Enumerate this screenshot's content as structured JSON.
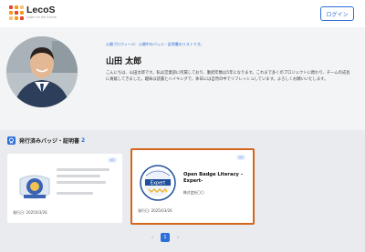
{
  "header": {
    "logo_name": "LecoS",
    "logo_tagline": "Learn for the Future",
    "login_label": "ログイン"
  },
  "profile": {
    "breadcrumb": "公開プロフィール：公開中のバッジ・証明書のリストです。",
    "name": "山田 太郎",
    "bio": "こんにちは、山田太郎です。私は営業部に所属しており、勤続年数は5年になります。これまで多くのプロジェクトに携わり、チームの成長に貢献してきました。趣味は読書とハイキングで、休日には自然の中でリフレッシュしています。よろしくお願いいたします。"
  },
  "badges": {
    "title": "発行済みバッジ・証明書",
    "count": "2",
    "cards": [
      {
        "pill": "v1",
        "title": "",
        "issuer": "",
        "date": "発行日: 2025/03/26"
      },
      {
        "pill": "v1",
        "title": "Open Badge Literacy -Expert-",
        "issuer": "株式会社〇〇",
        "date": "発行日: 2025/03/26"
      }
    ]
  },
  "pagination": {
    "prev": "‹",
    "current": "1",
    "next": "›"
  },
  "colors": {
    "accent": "#2f6fd8",
    "highlight_border": "#d4651c"
  }
}
